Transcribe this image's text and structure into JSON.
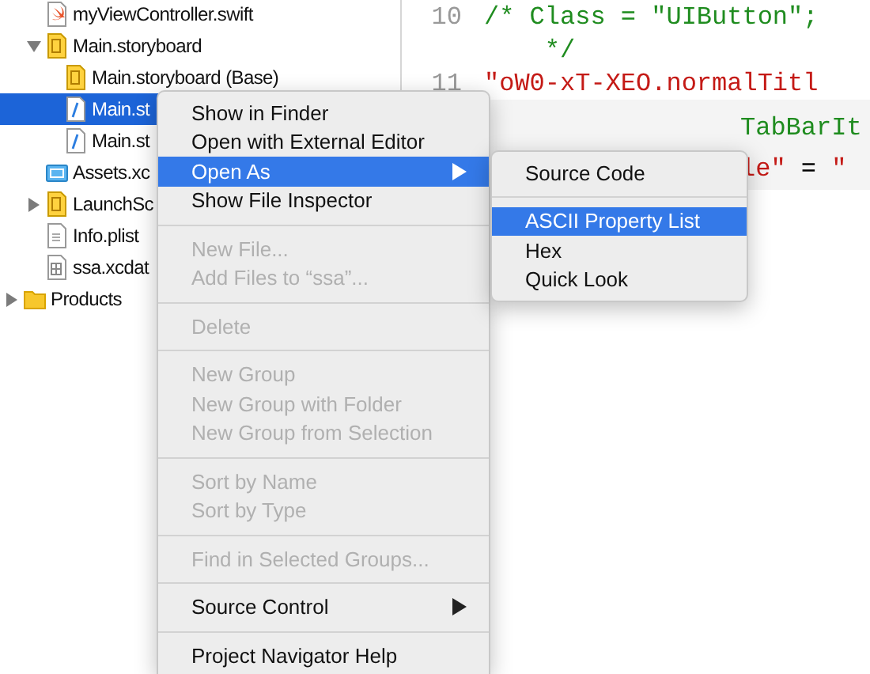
{
  "navigator": {
    "items": [
      {
        "name": "myViewController.swift",
        "kind": "swift",
        "selected": false
      },
      {
        "name": "Main.storyboard",
        "kind": "storyboard",
        "expanded": true,
        "selected": false,
        "children": [
          {
            "name": "Main.storyboard (Base)",
            "kind": "storyboard",
            "selected": false
          },
          {
            "name": "Main.st",
            "kind": "strings",
            "selected": true
          },
          {
            "name": "Main.st",
            "kind": "strings",
            "selected": false
          }
        ]
      },
      {
        "name": "Assets.xc",
        "kind": "assets",
        "selected": false
      },
      {
        "name": "LaunchSc",
        "kind": "storyboard",
        "expanded": false,
        "selected": false
      },
      {
        "name": "Info.plist",
        "kind": "plist",
        "selected": false
      },
      {
        "name": "ssa.xcdat",
        "kind": "datamodel",
        "selected": false
      }
    ],
    "top_items": [
      {
        "name": "Products",
        "kind": "folder",
        "expanded": false,
        "selected": false
      }
    ]
  },
  "editor": {
    "lines": [
      {
        "number": "10",
        "covered": false,
        "tokens": [
          {
            "text": "/* Class = \"UIButton\";",
            "kind": "comment"
          }
        ]
      },
      {
        "covered": false,
        "tokens": [
          {
            "text": "    */",
            "kind": "comment"
          }
        ]
      },
      {
        "number": "11",
        "covered": false,
        "tokens": [
          {
            "text": "\"oW0-xT-XEO.normalTitl",
            "kind": "string"
          }
        ]
      },
      {
        "covered": true,
        "tokens": [
          {
            "text": "TabBarIt",
            "kind": "comment"
          }
        ]
      },
      {
        "covered": true,
        "tokens": [
          {
            "text": "le\"",
            "kind": "string"
          },
          {
            "text": " = ",
            "kind": "plain"
          },
          {
            "text": "\"",
            "kind": "string"
          }
        ]
      }
    ]
  },
  "context_menu": {
    "items": [
      {
        "kind": "item",
        "label": "Show in Finder",
        "disabled": false,
        "submenu": false,
        "selected": false
      },
      {
        "kind": "item",
        "label": "Open with External Editor",
        "disabled": false,
        "submenu": false,
        "selected": false
      },
      {
        "kind": "item",
        "label": "Open As",
        "disabled": false,
        "submenu": true,
        "selected": true
      },
      {
        "kind": "item",
        "label": "Show File Inspector",
        "disabled": false,
        "submenu": false,
        "selected": false
      },
      {
        "kind": "separator"
      },
      {
        "kind": "item",
        "label": "New File...",
        "disabled": true,
        "submenu": false,
        "selected": false
      },
      {
        "kind": "item",
        "label": "Add Files to “ssa”...",
        "disabled": true,
        "submenu": false,
        "selected": false
      },
      {
        "kind": "separator"
      },
      {
        "kind": "item",
        "label": "Delete",
        "disabled": true,
        "submenu": false,
        "selected": false
      },
      {
        "kind": "separator"
      },
      {
        "kind": "item",
        "label": "New Group",
        "disabled": true,
        "submenu": false,
        "selected": false
      },
      {
        "kind": "item",
        "label": "New Group with Folder",
        "disabled": true,
        "submenu": false,
        "selected": false
      },
      {
        "kind": "item",
        "label": "New Group from Selection",
        "disabled": true,
        "submenu": false,
        "selected": false
      },
      {
        "kind": "separator"
      },
      {
        "kind": "item",
        "label": "Sort by Name",
        "disabled": true,
        "submenu": false,
        "selected": false
      },
      {
        "kind": "item",
        "label": "Sort by Type",
        "disabled": true,
        "submenu": false,
        "selected": false
      },
      {
        "kind": "separator"
      },
      {
        "kind": "item",
        "label": "Find in Selected Groups...",
        "disabled": true,
        "submenu": false,
        "selected": false
      },
      {
        "kind": "separator"
      },
      {
        "kind": "item",
        "label": "Source Control",
        "disabled": false,
        "submenu": true,
        "selected": false
      },
      {
        "kind": "separator"
      },
      {
        "kind": "item",
        "label": "Project Navigator Help",
        "disabled": false,
        "submenu": false,
        "selected": false
      }
    ]
  },
  "submenu": {
    "items": [
      {
        "kind": "item",
        "label": "Source Code",
        "disabled": false,
        "selected": false
      },
      {
        "kind": "separator"
      },
      {
        "kind": "item",
        "label": "ASCII Property List",
        "disabled": false,
        "selected": true
      },
      {
        "kind": "item",
        "label": "Hex",
        "disabled": false,
        "selected": false
      },
      {
        "kind": "item",
        "label": "Quick Look",
        "disabled": false,
        "selected": false
      }
    ]
  }
}
